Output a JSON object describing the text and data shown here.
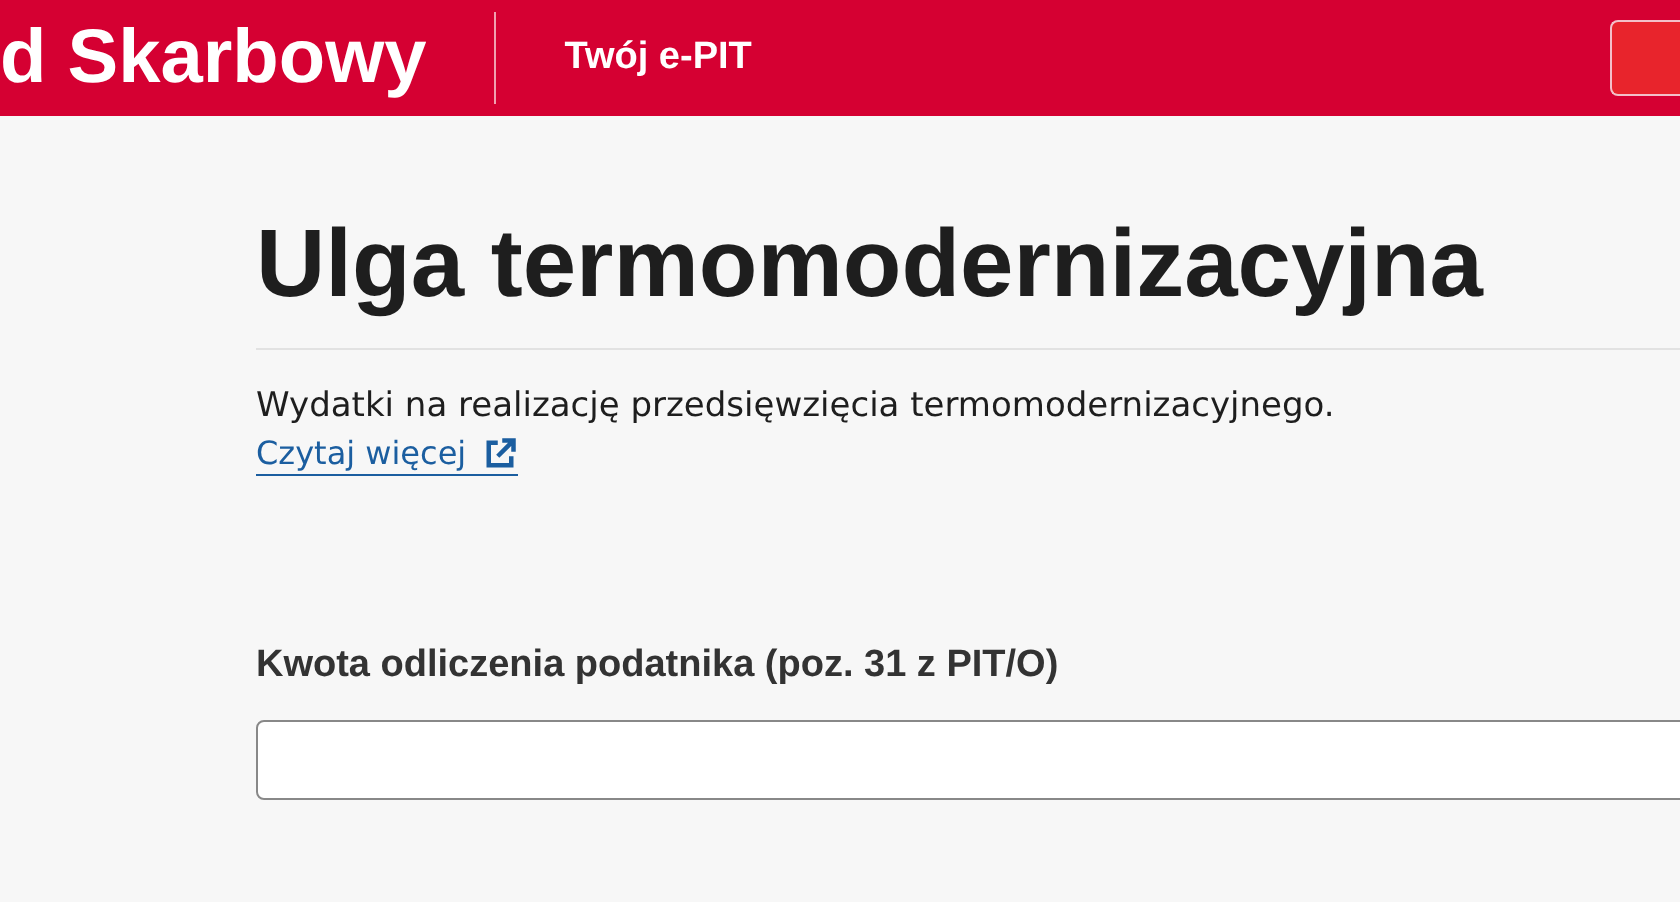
{
  "header": {
    "brand": "d Skarbowy",
    "app_name": "Twój e-PIT"
  },
  "page": {
    "title": "Ulga termomodernizacyjna",
    "description": "Wydatki na realizację przedsięwzięcia termomodernizacyjnego.",
    "read_more": "Czytaj więcej"
  },
  "field": {
    "label": "Kwota odliczenia podatnika (poz. 31 z PIT/O)"
  }
}
